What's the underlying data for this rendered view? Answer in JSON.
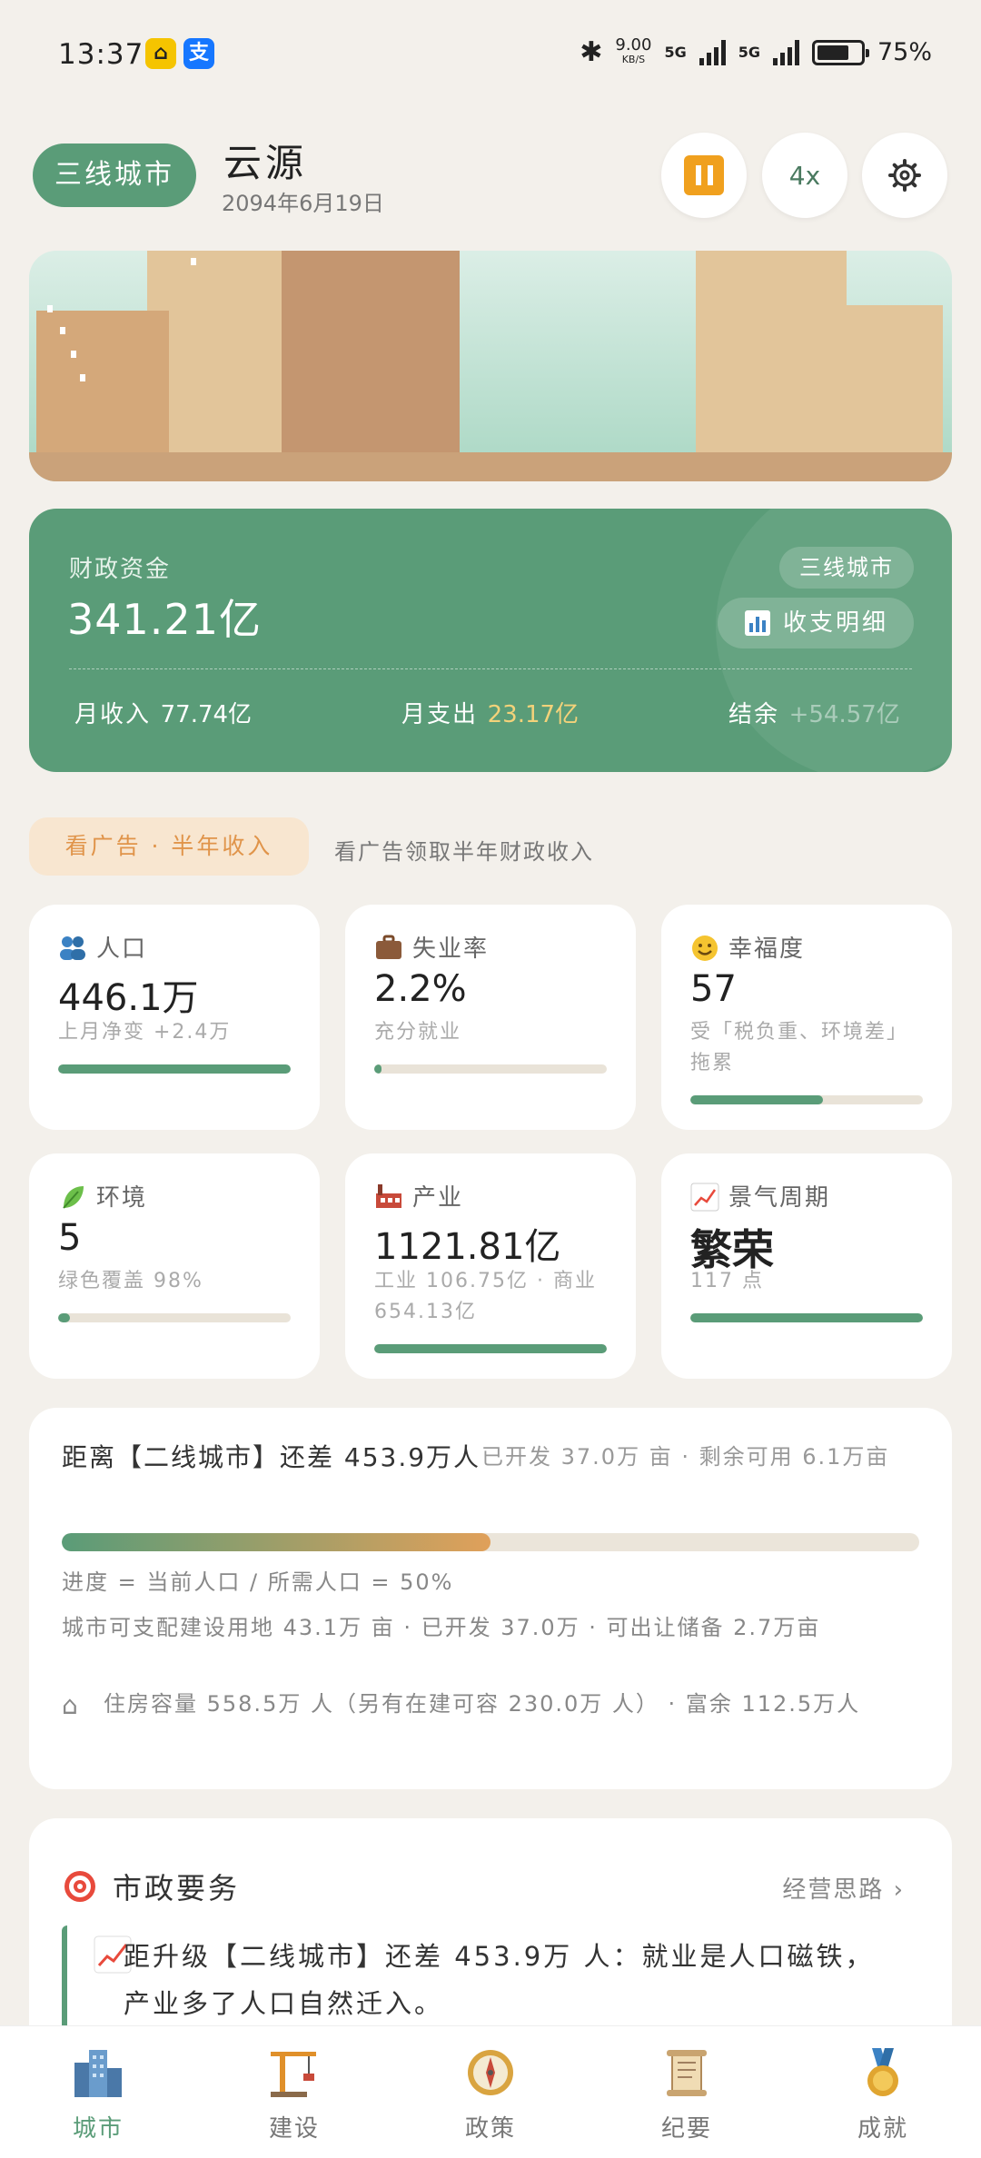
{
  "status_bar": {
    "time": "13:37",
    "speed": "9.00",
    "speed_unit": "KB/S",
    "net1": "5G",
    "net2": "5G",
    "battery": "75%"
  },
  "header": {
    "tier": "三线城市",
    "city": "云源",
    "date": "2094年6月19日",
    "speed_label": "4x"
  },
  "finance": {
    "label": "财政资金",
    "amount": "341.21亿",
    "tier": "三线城市",
    "detail_button": "收支明细",
    "income_label": "月收入",
    "income_value": "77.74亿",
    "expense_label": "月支出",
    "expense_value": "23.17亿",
    "balance_label": "结余",
    "balance_value": "+54.57亿"
  },
  "ad": {
    "button": "看广告 · 半年收入",
    "text": "看广告领取半年财政收入"
  },
  "stats": [
    {
      "title": "人口",
      "value": "446.1万",
      "sub": "上月净变 +2.4万",
      "level": 1.0,
      "icon": "people-icon"
    },
    {
      "title": "失业率",
      "value": "2.2%",
      "sub": "充分就业",
      "level": 0.022,
      "icon": "briefcase-icon"
    },
    {
      "title": "幸福度",
      "value": "57",
      "sub": "受「税负重、环境差」拖累",
      "level": 0.57,
      "icon": "smile-icon"
    },
    {
      "title": "环境",
      "value": "5",
      "sub": "绿色覆盖 98%",
      "level": 0.05,
      "icon": "leaf-icon"
    },
    {
      "title": "产业",
      "value": "1121.81亿",
      "sub": "工业 106.75亿 · 商业 654.13亿",
      "level": 1.0,
      "icon": "factory-icon"
    },
    {
      "title": "景气周期",
      "value": "繁荣",
      "sub": "117 点",
      "level": 1.0,
      "icon": "chart-up-icon"
    }
  ],
  "goal": {
    "title": "距离【二线城市】还差 453.9万人",
    "side": "已开发 37.0万 亩 · 剩余可用 6.1万亩",
    "progress": 0.5,
    "progress_text": "进度 = 当前人口 / 所需人口 = 50%",
    "land_text": "城市可支配建设用地 43.1万 亩 · 已开发 37.0万 · 可出让储备 2.7万亩",
    "housing_text": "住房容量 558.5万 人（另有在建可容 230.0万 人） · 富余 112.5万人"
  },
  "mission": {
    "title": "市政要务",
    "link": "经营思路 ›",
    "text": "距升级【二线城市】还差 453.9万 人：就业是人口磁铁，产业多了人口自然迁入。"
  },
  "nav": [
    {
      "label": "城市",
      "icon": "city-icon",
      "active": true
    },
    {
      "label": "建设",
      "icon": "crane-icon",
      "active": false
    },
    {
      "label": "政策",
      "icon": "compass-icon",
      "active": false
    },
    {
      "label": "纪要",
      "icon": "scroll-icon",
      "active": false
    },
    {
      "label": "成就",
      "icon": "medal-icon",
      "active": false
    }
  ],
  "colors": {
    "primary_green": "#5a9c78",
    "background": "#f3f0eb",
    "ad_orange": "#e0944a",
    "expense_yellow": "#f3d27a"
  }
}
